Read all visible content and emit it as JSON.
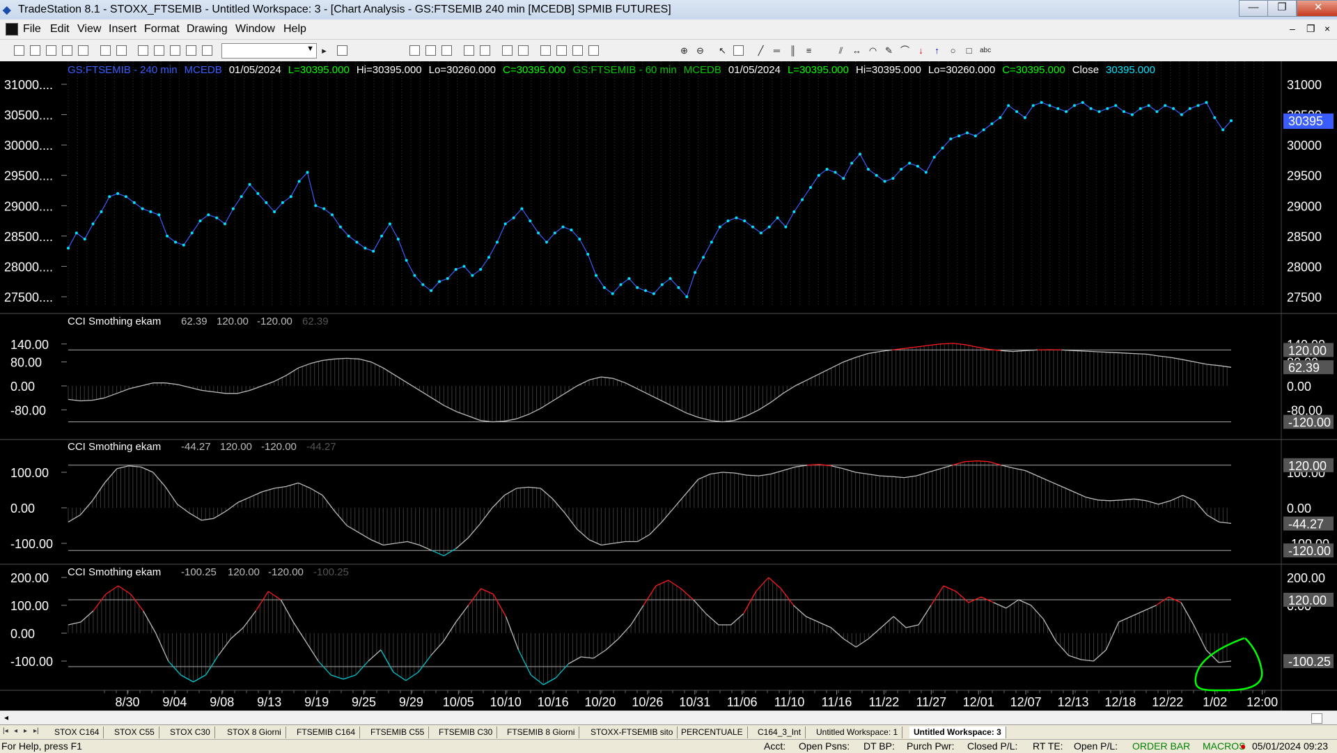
{
  "window": {
    "title": "TradeStation 8.1 - STOXX_FTSEMIB - Untitled Workspace:  3 - [Chart Analysis - GS:FTSEMIB  240 min  [MCEDB] SPMIB FUTURES]",
    "minimize": "—",
    "restore": "❐",
    "close": "✕"
  },
  "menu": {
    "items": [
      "File",
      "Edit",
      "View",
      "Insert",
      "Format",
      "Drawing",
      "Window",
      "Help"
    ]
  },
  "mdi_buttons": [
    "–",
    "❐",
    "×"
  ],
  "toolbar": {
    "combo_value": ""
  },
  "chart": {
    "header": [
      {
        "text": "GS:FTSEMIB - 240 min",
        "color": "#3a5dff"
      },
      {
        "text": "MCEDB",
        "color": "#3a5dff"
      },
      {
        "text": "01/05/2024",
        "color": "#ffffff"
      },
      {
        "text": "L=30395.000",
        "color": "#00ff00"
      },
      {
        "text": "Hi=30395.000",
        "color": "#ffffff"
      },
      {
        "text": "Lo=30260.000",
        "color": "#ffffff"
      },
      {
        "text": "C=30395.000",
        "color": "#00ff00"
      },
      {
        "text": "GS:FTSEMIB - 60 min",
        "color": "#00c800"
      },
      {
        "text": "MCEDB",
        "color": "#00c800"
      },
      {
        "text": "01/05/2024",
        "color": "#ffffff"
      },
      {
        "text": "L=30395.000",
        "color": "#00ff00"
      },
      {
        "text": "Hi=30395.000",
        "color": "#ffffff"
      },
      {
        "text": "Lo=30260.000",
        "color": "#ffffff"
      },
      {
        "text": "C=30395.000",
        "color": "#00ff00"
      },
      {
        "text": "Close",
        "color": "#ffffff"
      },
      {
        "text": "30395.000",
        "color": "#00e5ff"
      }
    ],
    "price_left_ticks": [
      "31000....",
      "30500....",
      "30000....",
      "29500....",
      "29000....",
      "28500....",
      "28000....",
      "27500...."
    ],
    "price_right_ticks": [
      "31000",
      "30500",
      "30000",
      "29500",
      "29000",
      "28500",
      "28000",
      "27500"
    ],
    "last_price": "30395",
    "x_labels": [
      "8/30",
      "9/04",
      "9/08",
      "9/13",
      "9/19",
      "9/25",
      "9/29",
      "10/05",
      "10/10",
      "10/16",
      "10/20",
      "10/26",
      "10/31",
      "11/06",
      "11/10",
      "11/16",
      "11/22",
      "11/27",
      "12/01",
      "12/07",
      "12/13",
      "12/18",
      "12/22",
      "1/02",
      "12:00"
    ],
    "indicators": [
      {
        "name": "CCI Smothing ekam",
        "values": [
          "62.39",
          "120.00",
          "-120.00",
          "62.39"
        ],
        "left_ticks": [
          "140.00",
          "80.00",
          "0.00",
          "-80.00"
        ],
        "right_ticks": [
          "140.00",
          "80.00",
          "0.00",
          "-80.00"
        ],
        "right_boxes": [
          "120.00",
          "62.39",
          "-120.00"
        ]
      },
      {
        "name": "CCI Smothing ekam",
        "values": [
          "-44.27",
          "120.00",
          "-120.00",
          "-44.27"
        ],
        "left_ticks": [
          "100.00",
          "0.00",
          "-100.00"
        ],
        "right_ticks": [
          "100.00",
          "0.00",
          "-100.00"
        ],
        "right_boxes": [
          "120.00",
          "-44.27",
          "-120.00"
        ]
      },
      {
        "name": "CCI Smothing ekam",
        "values": [
          "-100.25",
          "120.00",
          "-120.00",
          "-100.25"
        ],
        "left_ticks": [
          "200.00",
          "100.00",
          "0.00",
          "-100.00"
        ],
        "right_ticks": [
          "200.00",
          "0.00"
        ],
        "right_boxes": [
          "120.00",
          "-100.25"
        ]
      }
    ]
  },
  "chart_data": {
    "type": "line",
    "price_series": [
      28300,
      28550,
      28450,
      28700,
      28900,
      29150,
      29200,
      29150,
      29050,
      28950,
      28900,
      28850,
      28500,
      28400,
      28350,
      28550,
      28750,
      28850,
      28800,
      28700,
      28950,
      29150,
      29350,
      29200,
      29050,
      28900,
      29050,
      29150,
      29400,
      29550,
      29000,
      28950,
      28850,
      28650,
      28500,
      28400,
      28300,
      28250,
      28500,
      28700,
      28450,
      28100,
      27850,
      27700,
      27600,
      27750,
      27800,
      27950,
      28000,
      27850,
      27950,
      28150,
      28400,
      28700,
      28800,
      28950,
      28750,
      28550,
      28400,
      28550,
      28650,
      28600,
      28450,
      28200,
      27850,
      27650,
      27550,
      27700,
      27800,
      27650,
      27600,
      27550,
      27700,
      27800,
      27650,
      27500,
      27900,
      28150,
      28400,
      28650,
      28750,
      28800,
      28750,
      28650,
      28550,
      28650,
      28800,
      28650,
      28900,
      29100,
      29300,
      29500,
      29600,
      29550,
      29450,
      29700,
      29850,
      29600,
      29500,
      29400,
      29450,
      29600,
      29700,
      29650,
      29550,
      29800,
      29950,
      30100,
      30150,
      30200,
      30150,
      30250,
      30350,
      30450,
      30650,
      30550,
      30450,
      30650,
      30700,
      30650,
      30600,
      30550,
      30650,
      30700,
      30600,
      30550,
      30600,
      30650,
      30550,
      30500,
      30600,
      30650,
      30550,
      30650,
      30600,
      30500,
      30600,
      30650,
      30700,
      30450,
      30250,
      30400
    ],
    "cci1": [
      -45,
      -50,
      -48,
      -40,
      -25,
      -10,
      0,
      10,
      10,
      5,
      -5,
      -15,
      -20,
      -25,
      -25,
      -15,
      0,
      15,
      35,
      60,
      75,
      85,
      90,
      92,
      90,
      80,
      60,
      35,
      10,
      -15,
      -40,
      -65,
      -85,
      -100,
      -115,
      -120,
      -118,
      -110,
      -95,
      -75,
      -50,
      -25,
      0,
      20,
      30,
      25,
      10,
      -10,
      -30,
      -50,
      -70,
      -90,
      -105,
      -115,
      -120,
      -115,
      -100,
      -80,
      -55,
      -25,
      0,
      20,
      40,
      60,
      80,
      95,
      108,
      115,
      120,
      125,
      130,
      135,
      140,
      142,
      138,
      130,
      122,
      118,
      115,
      118,
      120,
      121,
      120,
      118,
      116,
      114,
      112,
      110,
      108,
      106,
      100,
      95,
      88,
      80,
      72,
      68,
      62
    ],
    "cci2": [
      -40,
      -20,
      20,
      70,
      110,
      118,
      115,
      100,
      60,
      10,
      -15,
      -35,
      -30,
      -10,
      15,
      30,
      45,
      55,
      60,
      70,
      55,
      35,
      -10,
      -50,
      -70,
      -90,
      -105,
      -100,
      -95,
      -105,
      -120,
      -135,
      -115,
      -85,
      -45,
      0,
      35,
      55,
      58,
      55,
      25,
      -15,
      -60,
      -90,
      -105,
      -100,
      -95,
      -95,
      -75,
      -40,
      0,
      40,
      80,
      95,
      100,
      98,
      92,
      90,
      95,
      105,
      115,
      120,
      122,
      118,
      110,
      100,
      95,
      90,
      88,
      85,
      90,
      100,
      110,
      120,
      130,
      132,
      130,
      120,
      112,
      105,
      90,
      75,
      60,
      45,
      30,
      22,
      20,
      22,
      25,
      20,
      10,
      20,
      35,
      20,
      -20,
      -40,
      -44
    ],
    "cci3": [
      30,
      40,
      80,
      140,
      170,
      140,
      80,
      0,
      -100,
      -150,
      -175,
      -150,
      -80,
      -20,
      20,
      80,
      150,
      120,
      40,
      -30,
      -100,
      -150,
      -165,
      -150,
      -100,
      -60,
      -140,
      -170,
      -140,
      -80,
      -30,
      40,
      100,
      160,
      140,
      60,
      -60,
      -150,
      -185,
      -160,
      -110,
      -85,
      -90,
      -60,
      -20,
      30,
      100,
      170,
      190,
      160,
      120,
      70,
      30,
      30,
      70,
      150,
      200,
      160,
      100,
      60,
      40,
      20,
      -20,
      -50,
      -20,
      20,
      60,
      20,
      30,
      100,
      170,
      150,
      110,
      130,
      110,
      90,
      120,
      100,
      50,
      -30,
      -80,
      -95,
      -100,
      -60,
      40,
      60,
      80,
      100,
      130,
      110,
      30,
      -60,
      -105,
      -100
    ]
  },
  "tabs": [
    "STOX C164",
    "STOX C55",
    "STOX  C30",
    "STOX  8 Giorni",
    "FTSEMIB C164",
    "FTSEMIB C55",
    "FTSEMIB C30",
    "FTSEMIB  8 Giorni",
    "STOXX-FTSEMIB sito",
    "PERCENTUALE",
    "C164_3_Int",
    "Untitled Workspace:  1",
    "Untitled Workspace:  3"
  ],
  "status": {
    "help": "For Help, press F1",
    "acct": "Acct:",
    "open_psns": "Open Psns:",
    "dt_bp": "DT BP:",
    "purch_pwr": "Purch Pwr:",
    "closed_pl": "Closed P/L:",
    "rt_te": "RT TE:",
    "open_pl": "Open P/L:",
    "order_bar": "ORDER BAR",
    "macros": "MACROS",
    "datetime": "05/01/2024 09:23"
  },
  "colors": {
    "price_line": "#3a5dff",
    "price_dot": "#00e5ff",
    "cci_line": "#bdbdbd",
    "over": "#ff1a1a",
    "under": "#00c8d0",
    "grid": "#444444",
    "annotation": "#00ff00"
  }
}
